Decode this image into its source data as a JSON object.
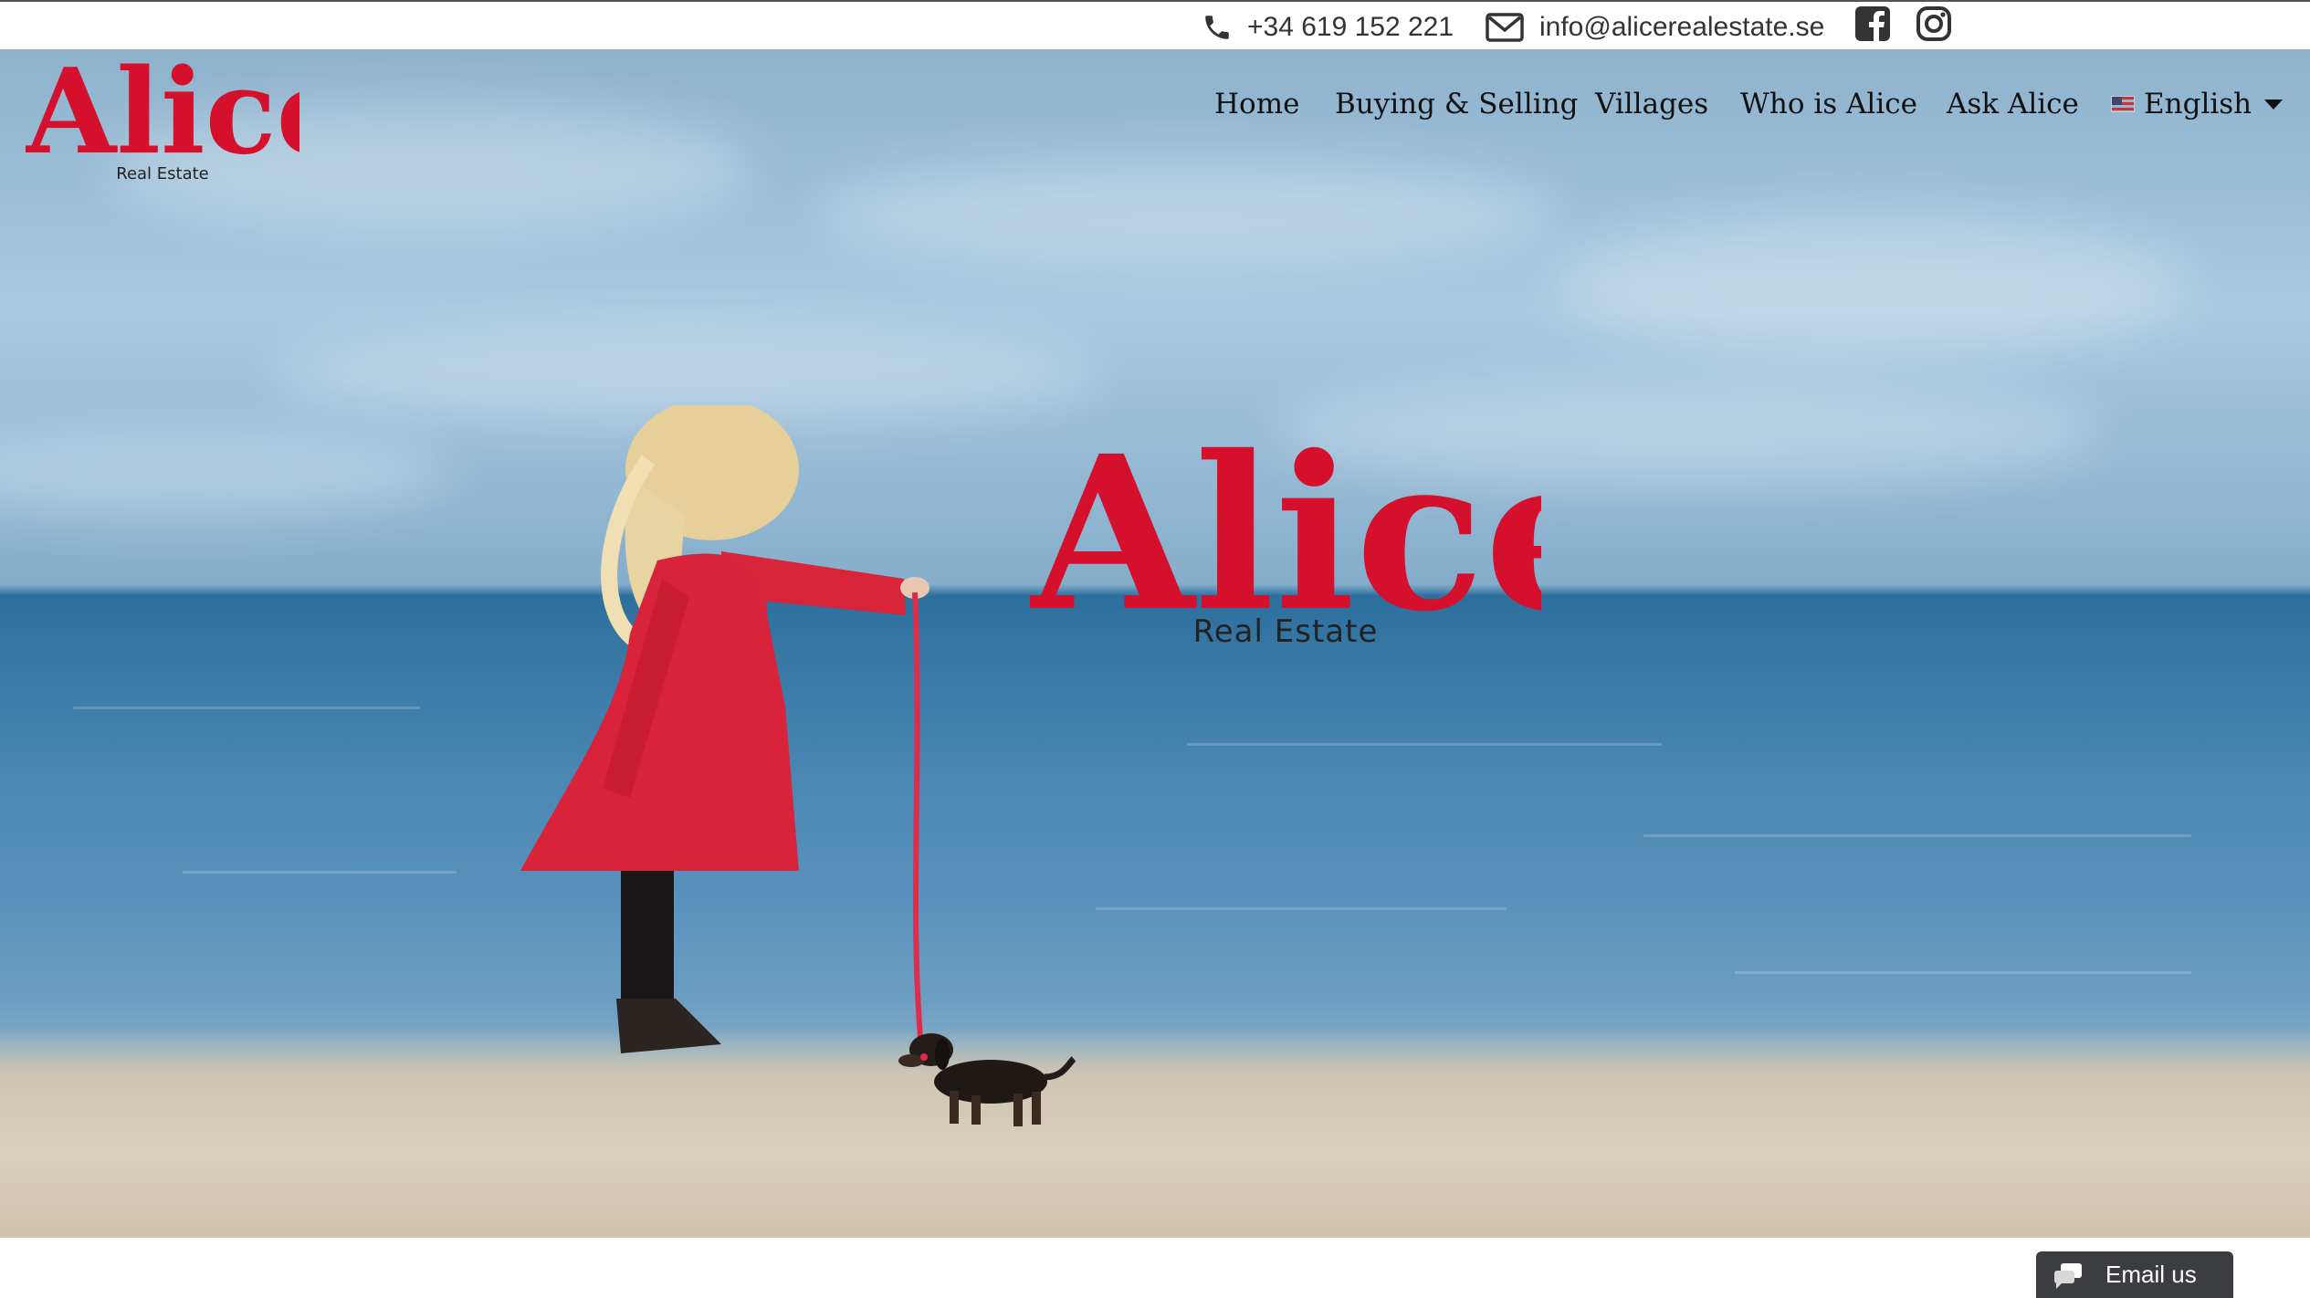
{
  "topbar": {
    "phone": "+34 619 152 221",
    "email": "info@alicerealestate.se",
    "icons": [
      "phone-icon",
      "envelope-icon",
      "facebook-icon",
      "instagram-icon"
    ]
  },
  "brand": {
    "name": "Alice",
    "tagline": "Real Estate",
    "color": "#d5102c"
  },
  "nav": {
    "items": [
      "Home",
      "Buying & Selling",
      "Villages",
      "Who is Alice",
      "Ask Alice"
    ],
    "language": "English"
  },
  "widget": {
    "email_us": "Email us"
  }
}
